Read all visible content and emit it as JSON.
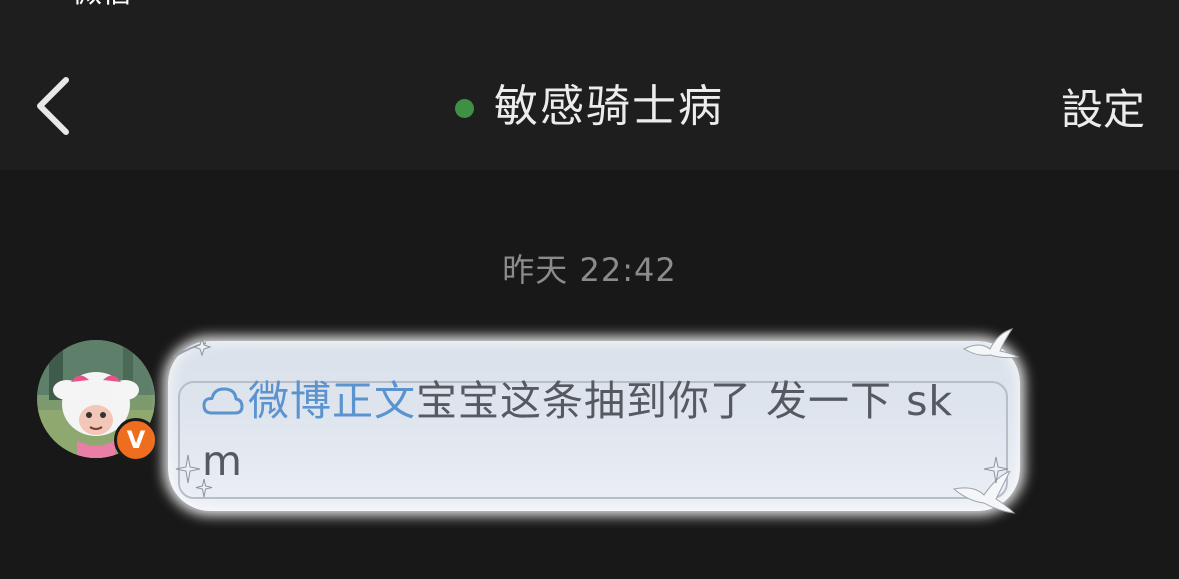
{
  "status_bar": {
    "text": "微信"
  },
  "header": {
    "title": "敏感骑士病",
    "settings_label": "設定",
    "online_color": "#3f8f45"
  },
  "chat": {
    "timestamp": "昨天 22:42",
    "message": {
      "sender_badge": "V",
      "link_label": "微博正文",
      "body": "宝宝这条抽到你了 发一下 skm"
    }
  },
  "icons": {
    "back": "chevron-left-icon",
    "link": "cloud-icon"
  },
  "colors": {
    "background": "#181818",
    "header": "#1e1e1e",
    "link": "#5b93cf",
    "badge": "#ee6d1e"
  }
}
